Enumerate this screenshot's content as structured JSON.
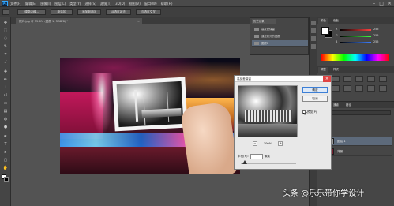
{
  "app": {
    "logo": "Ps"
  },
  "menubar": {
    "items": [
      "文件(F)",
      "编辑(E)",
      "图像(I)",
      "图层(L)",
      "类型(Y)",
      "选择(S)",
      "滤镜(T)",
      "3D(D)",
      "视图(V)",
      "窗口(W)",
      "帮助(H)"
    ],
    "window_controls": [
      "–",
      "□",
      "×"
    ]
  },
  "options_bar": {
    "buttons": [
      "调整边缘...",
      "新选区",
      "添加到选区",
      "从选区减去",
      "与选区交叉"
    ]
  },
  "document": {
    "tab_title": "照片.jpg @ 55.6% (图层 1, RGB/8) *",
    "close": "×"
  },
  "history_panel": {
    "tab": "历史记录",
    "rows": [
      "高反差保留",
      "通过拷贝的图层",
      "图层1"
    ]
  },
  "right_panel": {
    "tabs": [
      "颜色",
      "色板"
    ],
    "sliders": [
      {
        "label": "R",
        "value": "255",
        "color": "#ff4040"
      },
      {
        "label": "G",
        "value": "255",
        "color": "#40ff40"
      },
      {
        "label": "B",
        "value": "255",
        "color": "#4080ff"
      }
    ],
    "adjust_tabs": [
      "调整",
      "样式"
    ]
  },
  "layers_panel": {
    "tabs": [
      "图层",
      "通道",
      "路径"
    ],
    "layers": [
      {
        "name": "图层 1",
        "selected": true,
        "thumb_color": "#9a9a9a"
      },
      {
        "name": "背景",
        "selected": false,
        "thumb_color": "#7a1d2e"
      }
    ]
  },
  "dialog": {
    "title": "高反差保留",
    "close": "×",
    "buttons": {
      "ok": "确定",
      "cancel": "取消"
    },
    "preview_label": "预览(P)",
    "preview_checked": true,
    "zoom": {
      "minus": "−",
      "value": "100%",
      "plus": "+"
    },
    "radius": {
      "label": "半径(R):",
      "value": "",
      "unit": "像素"
    }
  },
  "watermark": {
    "text": "头条 @乐乐带你学设计"
  },
  "colors": {
    "accent": "#31a8ff",
    "selection": "#5d6a7b",
    "close_red": "#e04343"
  }
}
